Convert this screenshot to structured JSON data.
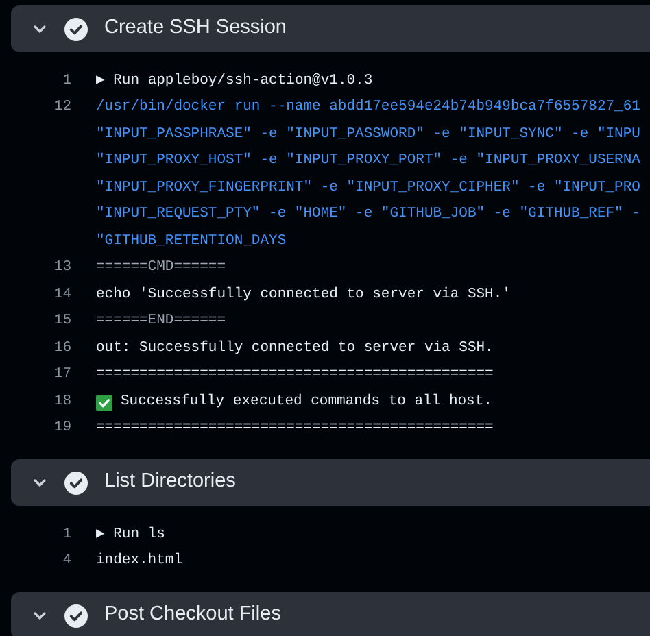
{
  "steps": [
    {
      "title": "Create SSH Session",
      "expanded": true,
      "lines": [
        {
          "number": "1",
          "kind": "group",
          "text": "▶ Run appleboy/ssh-action@v1.0.3"
        },
        {
          "number": "12",
          "kind": "command",
          "text": "/usr/bin/docker run --name abdd17ee594e24b74b949bca7f6557827_61"
        },
        {
          "kind": "command",
          "text": "\"INPUT_PASSPHRASE\" -e \"INPUT_PASSWORD\" -e \"INPUT_SYNC\" -e \"INPU"
        },
        {
          "kind": "command",
          "text": "\"INPUT_PROXY_HOST\" -e \"INPUT_PROXY_PORT\" -e \"INPUT_PROXY_USERNA"
        },
        {
          "kind": "command",
          "text": "\"INPUT_PROXY_FINGERPRINT\" -e \"INPUT_PROXY_CIPHER\" -e \"INPUT_PRO"
        },
        {
          "kind": "command",
          "text": "\"INPUT_REQUEST_PTY\" -e \"HOME\" -e \"GITHUB_JOB\" -e \"GITHUB_REF\" -"
        },
        {
          "kind": "command",
          "text": "\"GITHUB_RETENTION_DAYS"
        },
        {
          "number": "13",
          "kind": "muted",
          "text": "======CMD======"
        },
        {
          "number": "14",
          "kind": "plain",
          "text": "echo 'Successfully connected to server via SSH.'"
        },
        {
          "number": "15",
          "kind": "muted",
          "text": "======END======"
        },
        {
          "number": "16",
          "kind": "plain",
          "text": "out: Successfully connected to server via SSH."
        },
        {
          "number": "17",
          "kind": "plain",
          "text": "=============================================="
        },
        {
          "number": "18",
          "kind": "success",
          "text": "Successfully executed commands to all host."
        },
        {
          "number": "19",
          "kind": "plain",
          "text": "=============================================="
        }
      ]
    },
    {
      "title": "List Directories",
      "expanded": true,
      "lines": [
        {
          "number": "1",
          "kind": "group",
          "text": "▶ Run ls"
        },
        {
          "number": "4",
          "kind": "plain",
          "text": "index.html"
        }
      ]
    },
    {
      "title": "Post Checkout Files",
      "expanded": true
    }
  ]
}
